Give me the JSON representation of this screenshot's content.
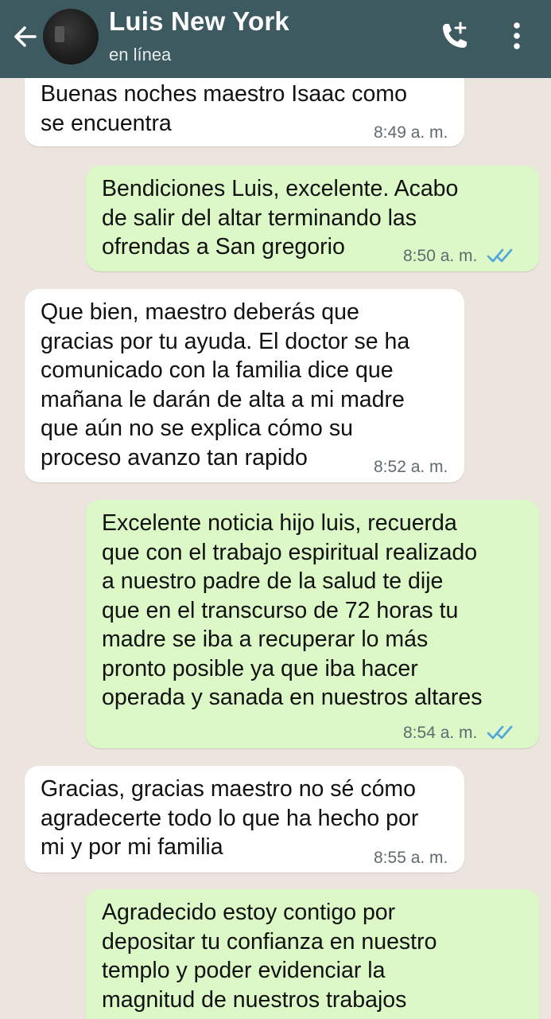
{
  "header": {
    "contact_name": "Luis New York",
    "status": "en línea",
    "icons": {
      "back": "arrow-left-icon",
      "call": "add-call-icon",
      "menu": "more-vertical-icon"
    },
    "colors": {
      "bar": "#3d5a60",
      "chat_bg": "#ece5dd",
      "incoming": "#ffffff",
      "outgoing": "#dcf8c6",
      "read_ticks": "#4fa3e0"
    }
  },
  "messages": [
    {
      "direction": "incoming",
      "text": "Buenas noches maestro Isaac como\nse encuentra",
      "time": "8:49 a. m."
    },
    {
      "direction": "outgoing",
      "text": "Bendiciones Luis, excelente. Acabo\nde salir del altar terminando las\nofrendas a San gregorio",
      "time": "8:50 a. m.",
      "status": "read"
    },
    {
      "direction": "incoming",
      "text": "Que bien, maestro deberás que\ngracias por tu ayuda. El doctor se ha\ncomunicado con la familia dice que\nmañana le darán de alta a mi madre\nque aún no se explica cómo su\nproceso avanzo tan rapido",
      "time": "8:52 a. m."
    },
    {
      "direction": "outgoing",
      "text": "Excelente noticia hijo luis, recuerda\nque con el trabajo espiritual realizado\na nuestro padre de la salud te dije\nque en el transcurso de 72 horas tu\nmadre se iba a recuperar lo más\npronto posible ya que iba hacer\noperada y sanada en nuestros altares",
      "time": "8:54 a. m.",
      "status": "read"
    },
    {
      "direction": "incoming",
      "text": "Gracias, gracias maestro no sé cómo\nagradecerte todo lo que ha hecho por\nmi y por mi familia",
      "time": "8:55 a. m."
    },
    {
      "direction": "outgoing",
      "text": "Agradecido estoy contigo por\ndepositar tu confianza en nuestro\ntemplo y poder evidenciar la\nmagnitud de nuestros trabajos",
      "time": ""
    }
  ]
}
